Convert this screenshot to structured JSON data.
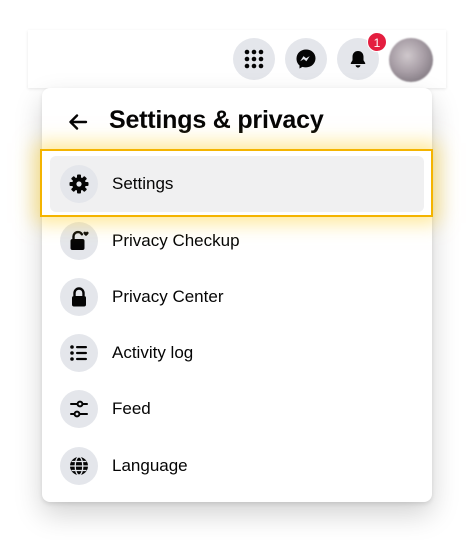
{
  "topbar": {
    "notifications_badge": "1",
    "icons": [
      "menu-grid-icon",
      "messenger-icon",
      "bell-icon",
      "profile-avatar"
    ]
  },
  "panel": {
    "title": "Settings & privacy",
    "items": [
      {
        "label": "Settings",
        "icon": "gear-icon"
      },
      {
        "label": "Privacy Checkup",
        "icon": "lock-heart-icon"
      },
      {
        "label": "Privacy Center",
        "icon": "lock-icon"
      },
      {
        "label": "Activity log",
        "icon": "list-icon"
      },
      {
        "label": "Feed",
        "icon": "sliders-icon"
      },
      {
        "label": "Language",
        "icon": "globe-icon"
      }
    ]
  },
  "colors": {
    "highlight": "#f4b400",
    "badge": "#e41e3f",
    "icon_bg": "#e4e6eb",
    "text": "#050505"
  }
}
